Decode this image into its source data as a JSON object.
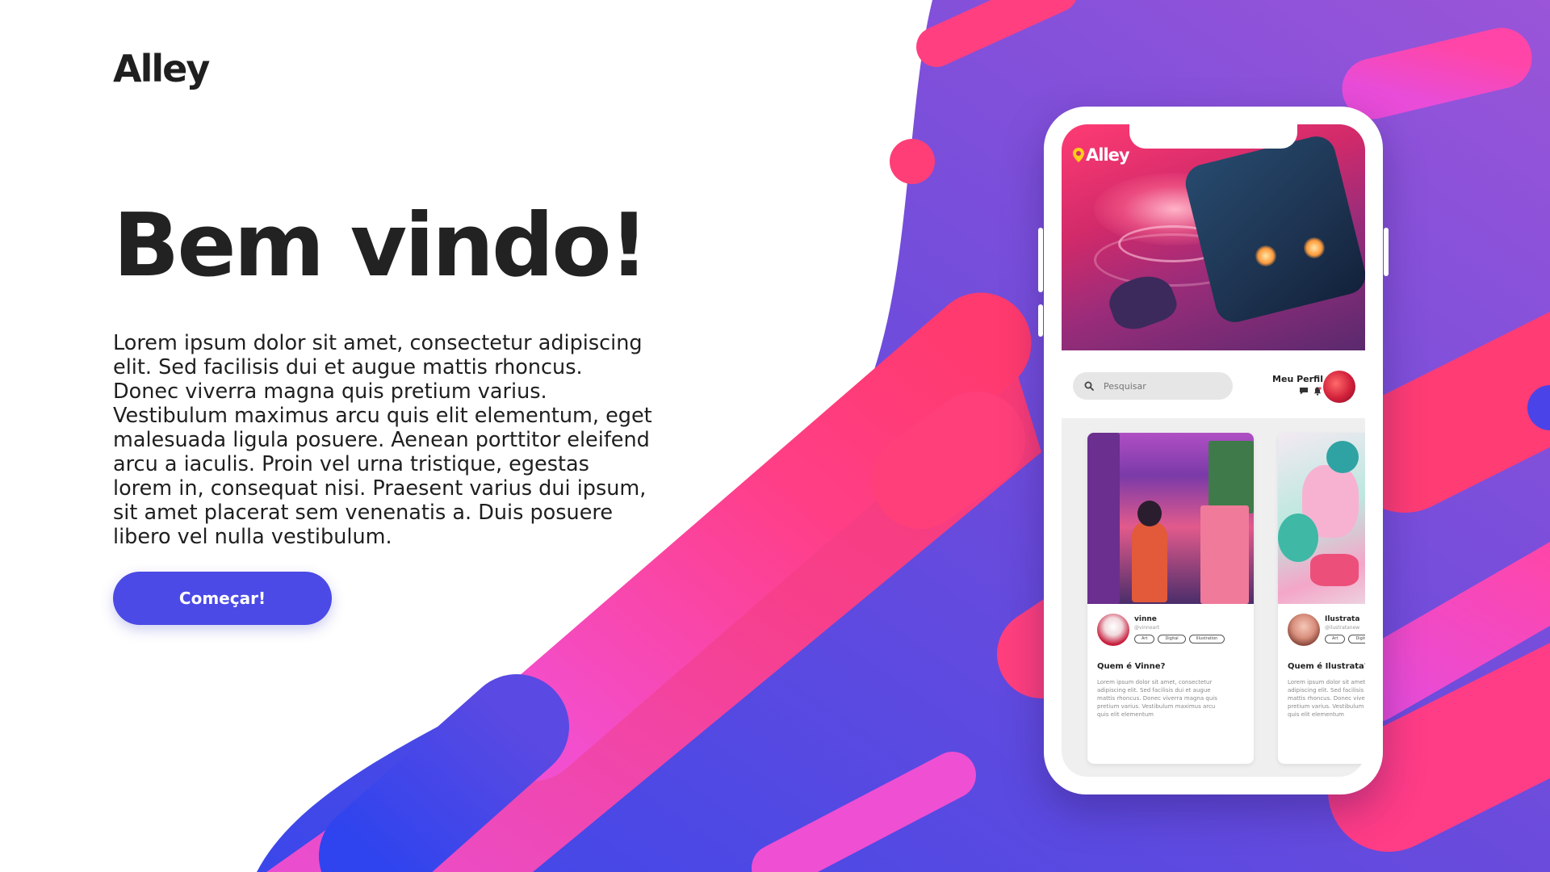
{
  "brand": {
    "logo_text": "Alley"
  },
  "hero": {
    "headline": "Bem vindo!",
    "intro": "Lorem ipsum dolor sit amet, consectetur adipiscing elit. Sed facilisis dui et augue mattis rhoncus. Donec viverra magna quis pretium varius. Vestibulum maximus arcu quis elit elementum, eget malesuada ligula posuere. Aenean porttitor eleifend arcu a iaculis. Proin vel urna tristique, egestas lorem in, consequat nisi. Praesent varius dui ipsum, sit amet placerat sem venenatis a. Duis posuere libero vel nulla vestibulum.",
    "cta_label": "Começar!"
  },
  "colors": {
    "accent": "#4b4ae6",
    "pink": "#ff3d7f",
    "magenta": "#e94bd6",
    "blue": "#4a44e8",
    "purple": "#7b4fd6"
  },
  "phone": {
    "app_logo": "Alley",
    "search": {
      "placeholder": "Pesquisar",
      "icon": "search-icon"
    },
    "profile": {
      "label": "Meu Perfil",
      "icons": [
        "chat-icon",
        "bell-icon"
      ]
    },
    "cards": [
      {
        "name": "vinne",
        "handle": "@vinneart",
        "tags": [
          "Art",
          "Digital",
          "Illustration"
        ],
        "title": "Quem é Vinne?",
        "text": "Lorem ipsum dolor sit amet, consectetur adipiscing elit. Sed facilisis dui et augue mattis rhoncus. Donec viverra magna quis pretium varius. Vestibulum maximus arcu quis elit elementum"
      },
      {
        "name": "Ilustrata",
        "handle": "@ilustratanew",
        "tags": [
          "Art",
          "Digital"
        ],
        "title": "Quem é Ilustrata?",
        "text": "Lorem ipsum dolor sit amet, consectetur adipiscing elit. Sed facilisis dui et augue mattis rhoncus. Donec viverra magna quis pretium varius. Vestibulum maximus arcu quis elit elementum"
      }
    ]
  }
}
